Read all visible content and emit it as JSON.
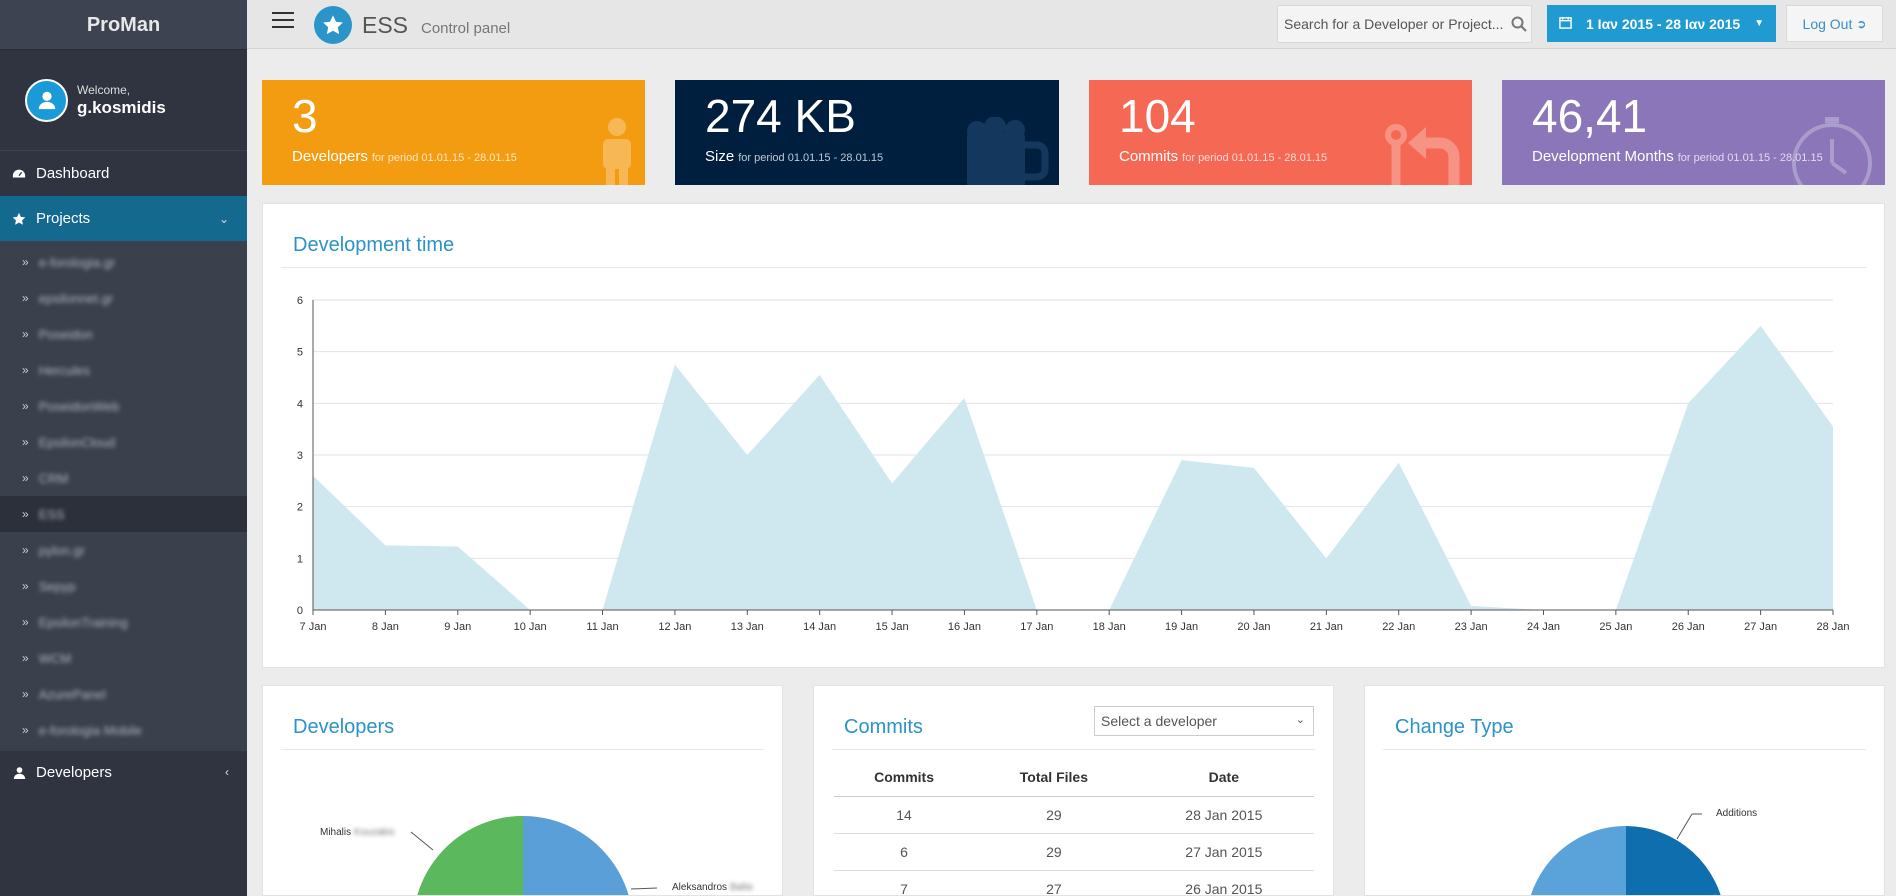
{
  "sidebar": {
    "brand": "ProMan",
    "welcome": "Welcome,",
    "username": "g.kosmidis",
    "dashboard": "Dashboard",
    "projects": "Projects",
    "project_items": [
      "e-forologia.gr",
      "epsilonnet.gr",
      "Poseidon",
      "Hercules",
      "PoseidonWeb",
      "EpsilonCloud",
      "CRM",
      "ESS",
      "pylon.gr",
      "Sepyp",
      "EpsilonTraining",
      "WCM",
      "AzurePanel",
      "e-forologia Mobile"
    ],
    "current_project_index": 7,
    "developers": "Developers"
  },
  "topbar": {
    "title": "ESS",
    "subtitle": "Control panel",
    "search_placeholder": "Search  for a Developer or Project...",
    "date_range": "1 Ιαν 2015 - 28 Ιαν 2015",
    "logout": "Log Out"
  },
  "kpis": [
    {
      "value": "3",
      "label": "Developers",
      "period": "for period 01.01.15 - 28.01.15",
      "color": "#f39c12"
    },
    {
      "value": "274 KB",
      "label": "Size",
      "period": "for period 01.01.15 - 28.01.15",
      "color": "#001f3f"
    },
    {
      "value": "104",
      "label": "Commits",
      "period": "for period 01.01.15 - 28.01.15",
      "color": "#f56954"
    },
    {
      "value": "46,41",
      "label": "Development Months",
      "period": "for period 01.01.15 - 28.01.15",
      "color": "#8a76b8"
    }
  ],
  "dev_time": {
    "title": "Development time"
  },
  "chart_data": {
    "type": "area",
    "title": "Development time",
    "x": [
      "7 Jan",
      "8 Jan",
      "9 Jan",
      "10 Jan",
      "11 Jan",
      "12 Jan",
      "13 Jan",
      "14 Jan",
      "15 Jan",
      "16 Jan",
      "17 Jan",
      "18 Jan",
      "19 Jan",
      "20 Jan",
      "21 Jan",
      "22 Jan",
      "23 Jan",
      "24 Jan",
      "25 Jan",
      "26 Jan",
      "27 Jan",
      "28 Jan"
    ],
    "y": [
      2.6,
      1.25,
      1.23,
      0,
      0,
      4.75,
      3.0,
      4.55,
      2.45,
      4.1,
      0,
      0,
      2.9,
      2.75,
      1.0,
      2.85,
      0.08,
      0,
      0,
      4.0,
      5.5,
      3.55
    ],
    "ylim": [
      0,
      6
    ],
    "yticks": [
      0,
      1,
      2,
      3,
      4,
      5,
      6
    ],
    "grid": true,
    "color": "#cfe8ef"
  },
  "developers_panel": {
    "title": "Developers",
    "label_mihalis": "Mihalis",
    "label_mihalis_surname": "Kouzakis",
    "label_aleksandros": "Aleksandros",
    "label_aleksandros_surname": "Balta"
  },
  "commits_panel": {
    "title": "Commits",
    "select_placeholder": "Select a developer",
    "columns": [
      "Commits",
      "Total Files",
      "Date"
    ],
    "rows": [
      [
        "14",
        "29",
        "28 Jan 2015"
      ],
      [
        "6",
        "29",
        "27 Jan 2015"
      ],
      [
        "7",
        "27",
        "26 Jan 2015"
      ]
    ]
  },
  "change_type_panel": {
    "title": "Change Type",
    "label_additions": "Additions"
  }
}
